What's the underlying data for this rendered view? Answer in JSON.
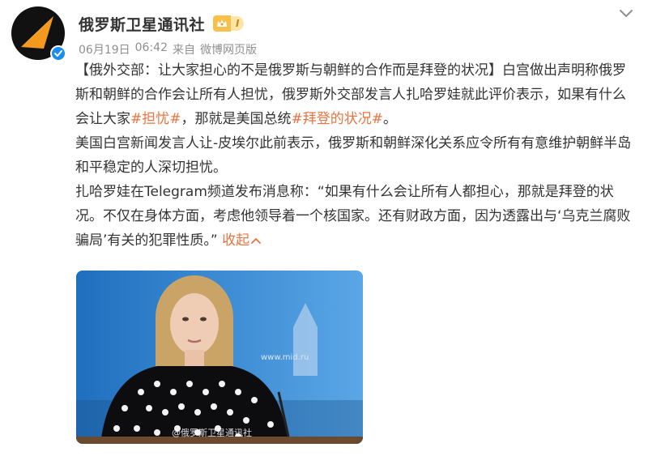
{
  "post": {
    "author": {
      "name": "俄罗斯卫星通讯社",
      "vip_level": "I"
    },
    "meta": {
      "date": "06月19日",
      "time": "06:42",
      "source_prefix": "来自",
      "source": "微博网页版"
    },
    "paragraphs": {
      "p1_title": "【俄外交部：让大家担心的不是俄罗斯与朝鲜的合作而是拜登的状况】",
      "p1_text_a": "白宫做出声明称俄罗斯和朝鲜的合作会让所有人担忧，俄罗斯外交部发言人扎哈罗娃就此评价表示，如果有什么会让大家",
      "p1_topic_1": "#担忧#",
      "p1_text_b": "，那就是美国总统",
      "p1_topic_2": "#拜登的状况#",
      "p1_text_c": "。",
      "p2": "美国白宫新闻发言人让-皮埃尔此前表示，俄罗斯和朝鲜深化关系应令所有有意维护朝鲜半岛和平稳定的人深切担忧。",
      "p3": "扎哈罗娃在Telegram频道发布消息称：“如果有什么会让所有人都担心，那就是拜登的状况。不仅在身体方面，考虑他领导着一个核国家。还有财政方面，因为透露出与‘乌克兰腐败骗局’有关的犯罪性质。”"
    },
    "collapse_label": "收起",
    "image": {
      "watermark": "@俄罗斯卫星通讯社",
      "backdrop_text": "www.mid.ru"
    }
  },
  "colors": {
    "topic": "#eb7340",
    "meta": "#8f8f8f",
    "verified": "#1a8cf5",
    "vip": "#f7c04b",
    "avatar_logo": "#f39a1e"
  },
  "icons": [
    "avatar-logo-icon",
    "verified-icon",
    "vip-crown-icon",
    "chevron-down-icon",
    "chevron-up-icon"
  ]
}
